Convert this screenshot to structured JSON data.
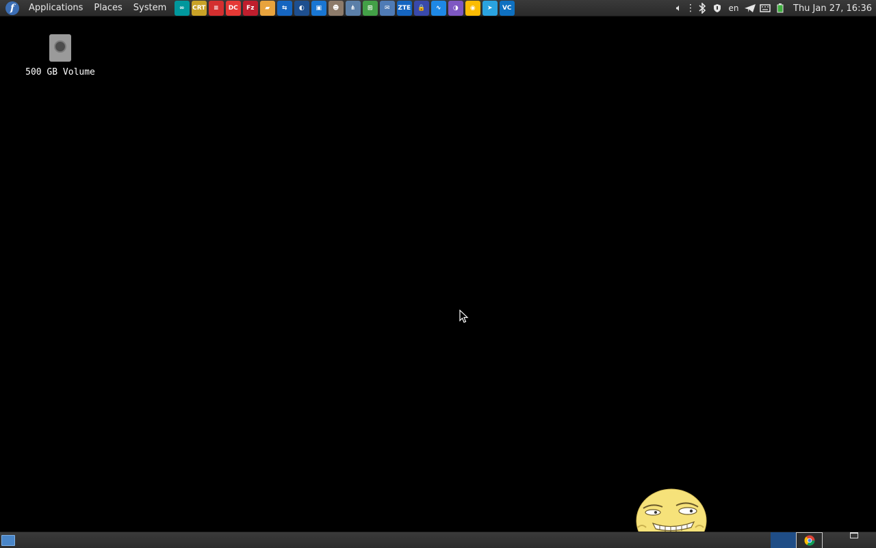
{
  "top_panel": {
    "menus": {
      "applications": "Applications",
      "places": "Places",
      "system": "System"
    },
    "launchers": [
      {
        "name": "arduino-icon",
        "glyph": "∞",
        "color": "#00979c"
      },
      {
        "name": "securecrt-icon",
        "glyph": "CRT",
        "color": "#c9a227"
      },
      {
        "name": "filezilla-server-icon",
        "glyph": "≡",
        "color": "#d32f2f"
      },
      {
        "name": "dcc-icon",
        "glyph": "DC",
        "color": "#e53935"
      },
      {
        "name": "filezilla-icon",
        "glyph": "Fz",
        "color": "#bf1e2d"
      },
      {
        "name": "file-manager-icon",
        "glyph": "▰",
        "color": "#e8a33d"
      },
      {
        "name": "teamviewer-icon",
        "glyph": "⇆",
        "color": "#1565c0"
      },
      {
        "name": "remote-desktop-icon",
        "glyph": "◐",
        "color": "#1e4f8f"
      },
      {
        "name": "vm-icon",
        "glyph": "▣",
        "color": "#1976d2"
      },
      {
        "name": "gimp-icon",
        "glyph": "☻",
        "color": "#8d7b6a"
      },
      {
        "name": "network-icon",
        "glyph": "⋔",
        "color": "#5b7fa8"
      },
      {
        "name": "display-icon",
        "glyph": "⊞",
        "color": "#43a047"
      },
      {
        "name": "document-icon",
        "glyph": "✉",
        "color": "#4f7bb5"
      },
      {
        "name": "zte-icon",
        "glyph": "ZTE",
        "color": "#1565c0"
      },
      {
        "name": "keepass-icon",
        "glyph": "🔒",
        "color": "#3949ab"
      },
      {
        "name": "oscilloscope-icon",
        "glyph": "∿",
        "color": "#1e88e5"
      },
      {
        "name": "tor-browser-icon",
        "glyph": "◑",
        "color": "#7e57c2"
      },
      {
        "name": "chrome-icon",
        "glyph": "◉",
        "color": "#fbbc04"
      },
      {
        "name": "telegram-icon",
        "glyph": "➤",
        "color": "#2aa3e0"
      },
      {
        "name": "vscode-icon",
        "glyph": "VC",
        "color": "#0e70c0"
      }
    ],
    "tray": {
      "volume_icon": "speaker-icon",
      "bluetooth_icon": "bluetooth-icon",
      "vpn_icon": "shield-icon",
      "keyboard_layout": "en",
      "telegram_tray_icon": "telegram-tray-icon",
      "keyboard_icon": "keyboard-icon",
      "battery_icon": "battery-icon",
      "clock": "Thu Jan 27, 16:36"
    }
  },
  "desktop": {
    "icons": [
      {
        "label": "500 GB Volume",
        "icon": "hard-drive-icon"
      }
    ]
  },
  "bottom_panel": {
    "show_desktop_icon": "show-desktop-icon",
    "workspaces": 2,
    "active_workspace": 1
  },
  "colors": {
    "desktop_background": "#000000",
    "panel_background": "#333333",
    "active_workspace": "#1f4d86"
  }
}
